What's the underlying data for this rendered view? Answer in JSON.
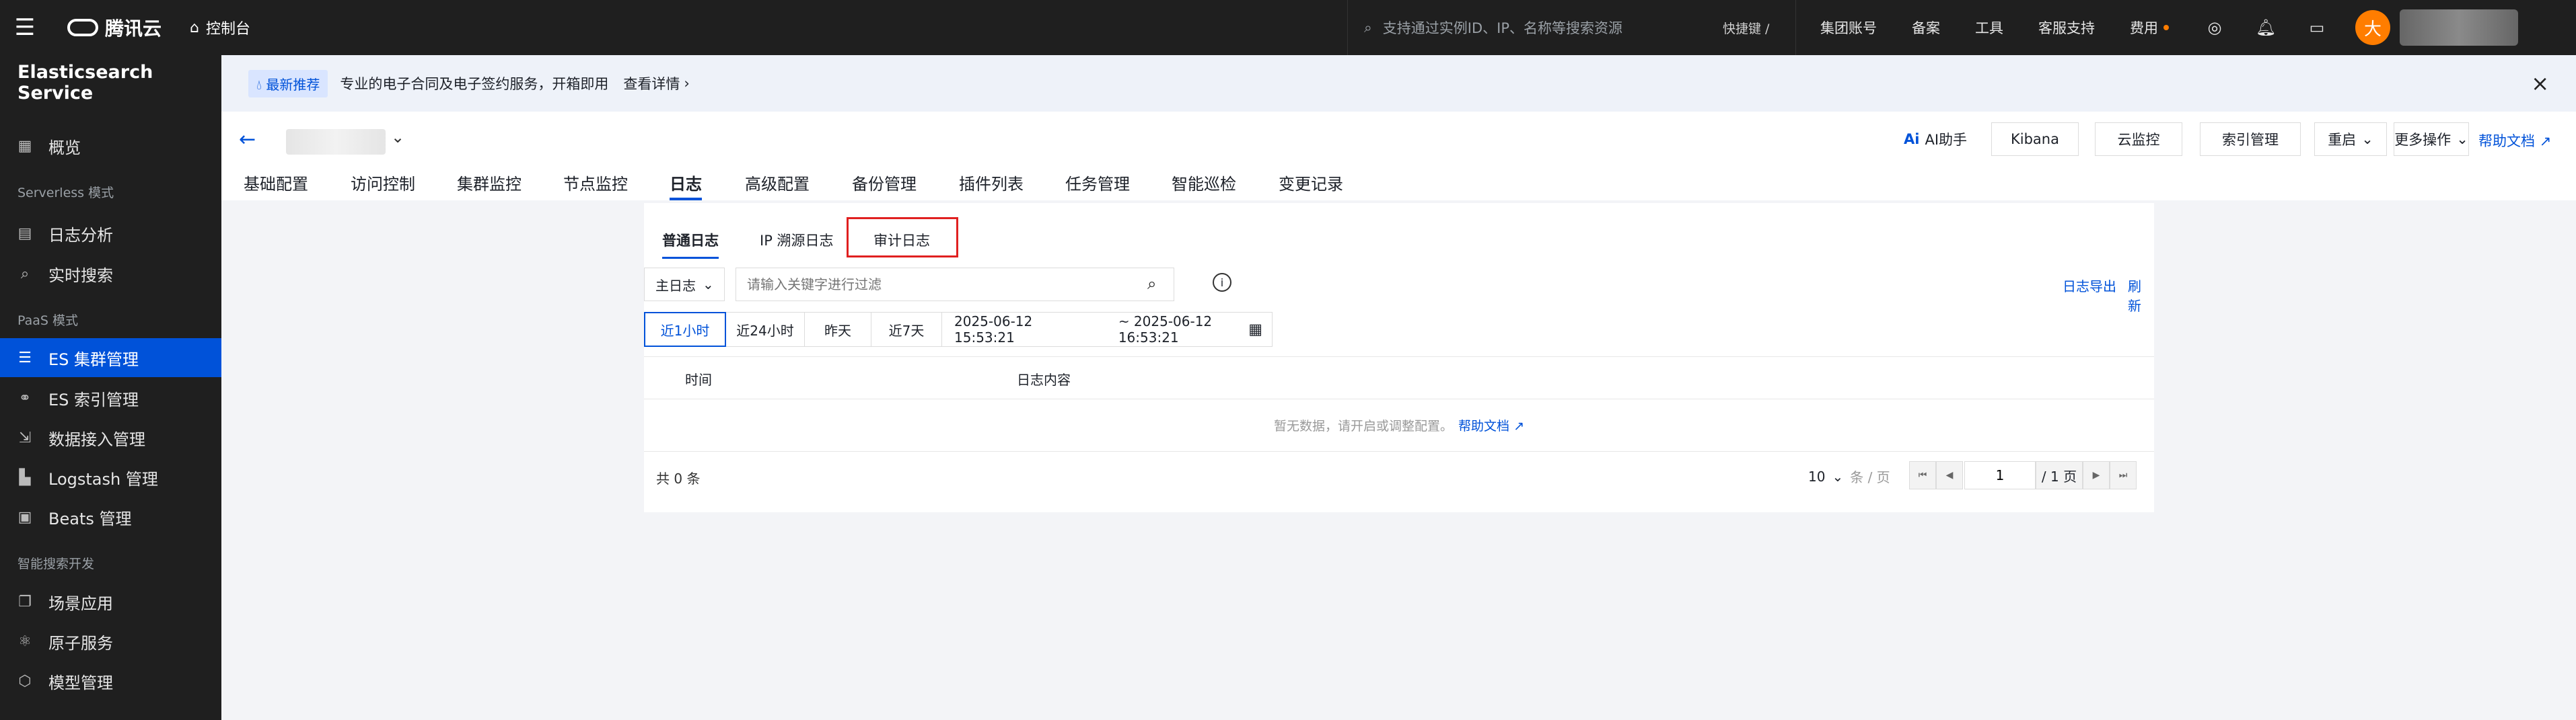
{
  "topbar": {
    "brand": "腾讯云",
    "console": "控制台",
    "search_placeholder": "支持通过实例ID、IP、名称等搜索资源",
    "shortcut": "快捷键 /",
    "links": [
      "集团账号",
      "备案",
      "工具",
      "客服支持",
      "费用"
    ],
    "avatar": "大"
  },
  "sidebar": {
    "title": "Elasticsearch Service",
    "items": [
      {
        "label": "概览",
        "group": ""
      },
      {
        "label": "Serverless 模式",
        "group": "header"
      },
      {
        "label": "日志分析"
      },
      {
        "label": "实时搜索"
      },
      {
        "label": "PaaS 模式",
        "group": "header"
      },
      {
        "label": "ES 集群管理",
        "active": true
      },
      {
        "label": "ES 索引管理"
      },
      {
        "label": "数据接入管理"
      },
      {
        "label": "Logstash 管理"
      },
      {
        "label": "Beats 管理"
      },
      {
        "label": "智能搜索开发",
        "group": "header"
      },
      {
        "label": "场景应用"
      },
      {
        "label": "原子服务"
      },
      {
        "label": "模型管理"
      }
    ]
  },
  "banner": {
    "tag": "最新推荐",
    "text": "专业的电子合同及电子签约服务，开箱即用",
    "more": "查看详情"
  },
  "header": {
    "ai": "AI助手",
    "buttons": [
      "Kibana",
      "云监控",
      "索引管理",
      "重启",
      "更多操作"
    ],
    "help": "帮助文档",
    "tabs": [
      "基础配置",
      "访问控制",
      "集群监控",
      "节点监控",
      "日志",
      "高级配置",
      "备份管理",
      "插件列表",
      "任务管理",
      "智能巡检",
      "变更记录"
    ],
    "active_tab": "日志"
  },
  "logs": {
    "subtabs": [
      "普通日志",
      "IP 溯源日志",
      "审计日志"
    ],
    "log_type": "主日志",
    "keyword_placeholder": "请输入关键字进行过滤",
    "export": "日志导出",
    "refresh": "刷新",
    "ranges": [
      "近1小时",
      "近24小时",
      "昨天",
      "近7天"
    ],
    "start": "2025-06-12 15:53:21",
    "end": "~ 2025-06-12 16:53:21",
    "columns": [
      "时间",
      "日志内容"
    ],
    "empty_text": "暂无数据，请开启或调整配置。",
    "empty_link": "帮助文档",
    "total": "共 0 条",
    "page_size": "10",
    "per_page": "条 / 页",
    "page": "1",
    "page_total": "/ 1 页"
  },
  "colors": {
    "accent": "#0052d9",
    "highlight": "#e02020"
  }
}
